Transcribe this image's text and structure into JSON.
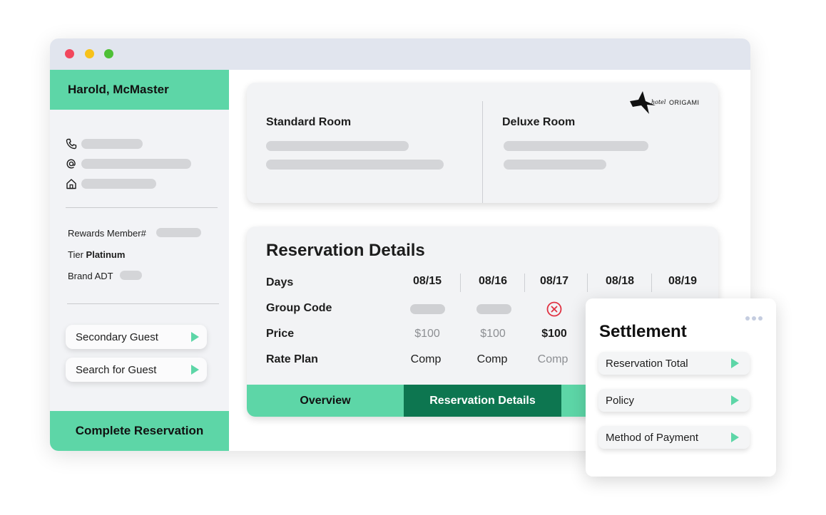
{
  "window": {
    "controls": [
      "close",
      "minimize",
      "maximize"
    ]
  },
  "sidebar": {
    "guest_name": "Harold, McMaster",
    "contact_icons": [
      "phone-icon",
      "at-sign-icon",
      "home-icon"
    ],
    "rewards_label": "Rewards Member#",
    "tier_label": "Tier",
    "tier_value": "Platinum",
    "brand_label": "Brand ADT",
    "secondary_guest": "Secondary Guest",
    "search_guest": "Search for Guest",
    "complete_reservation": "Complete Reservation"
  },
  "rooms": {
    "standard": "Standard Room",
    "deluxe": "Deluxe Room",
    "logo_text": "ORIGAMI",
    "logo_script": "hotel"
  },
  "details": {
    "title": "Reservation Details",
    "row_labels": {
      "days": "Days",
      "group_code": "Group Code",
      "price": "Price",
      "rate_plan": "Rate Plan"
    },
    "days": [
      "08/15",
      "08/16",
      "08/17",
      "08/18",
      "08/19"
    ],
    "prices": [
      "$100",
      "$100",
      "$100"
    ],
    "rate_plans": [
      "Comp",
      "Comp",
      "Comp"
    ],
    "tabs": {
      "overview": "Overview",
      "reservation_details": "Reservation Details"
    }
  },
  "settlement": {
    "title": "Settlement",
    "items": [
      "Reservation Total",
      "Policy",
      "Method of Payment"
    ]
  },
  "colors": {
    "accent": "#5dd6a7",
    "accent_dark": "#0d7650",
    "error": "#e03141",
    "titlebar": "#e1e5ee"
  }
}
